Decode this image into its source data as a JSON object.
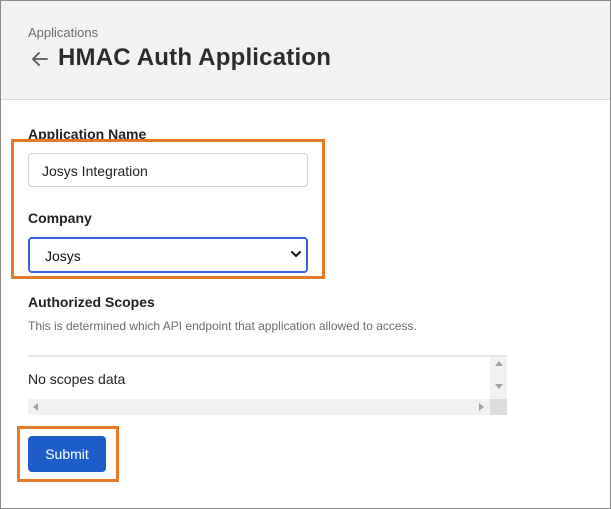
{
  "header": {
    "breadcrumb": "Applications",
    "title": "HMAC Auth Application",
    "back_icon": "arrow-left-icon"
  },
  "form": {
    "application_name": {
      "label": "Application Name",
      "value": "Josys Integration"
    },
    "company": {
      "label": "Company",
      "selected": "Josys"
    },
    "scopes": {
      "label": "Authorized Scopes",
      "description": "This is determined which API endpoint that application allowed to access.",
      "empty_text": "No scopes data"
    },
    "submit_label": "Submit"
  },
  "colors": {
    "highlight": "#e77a26",
    "primary": "#1c5dc9",
    "focus": "#3b62d6"
  }
}
